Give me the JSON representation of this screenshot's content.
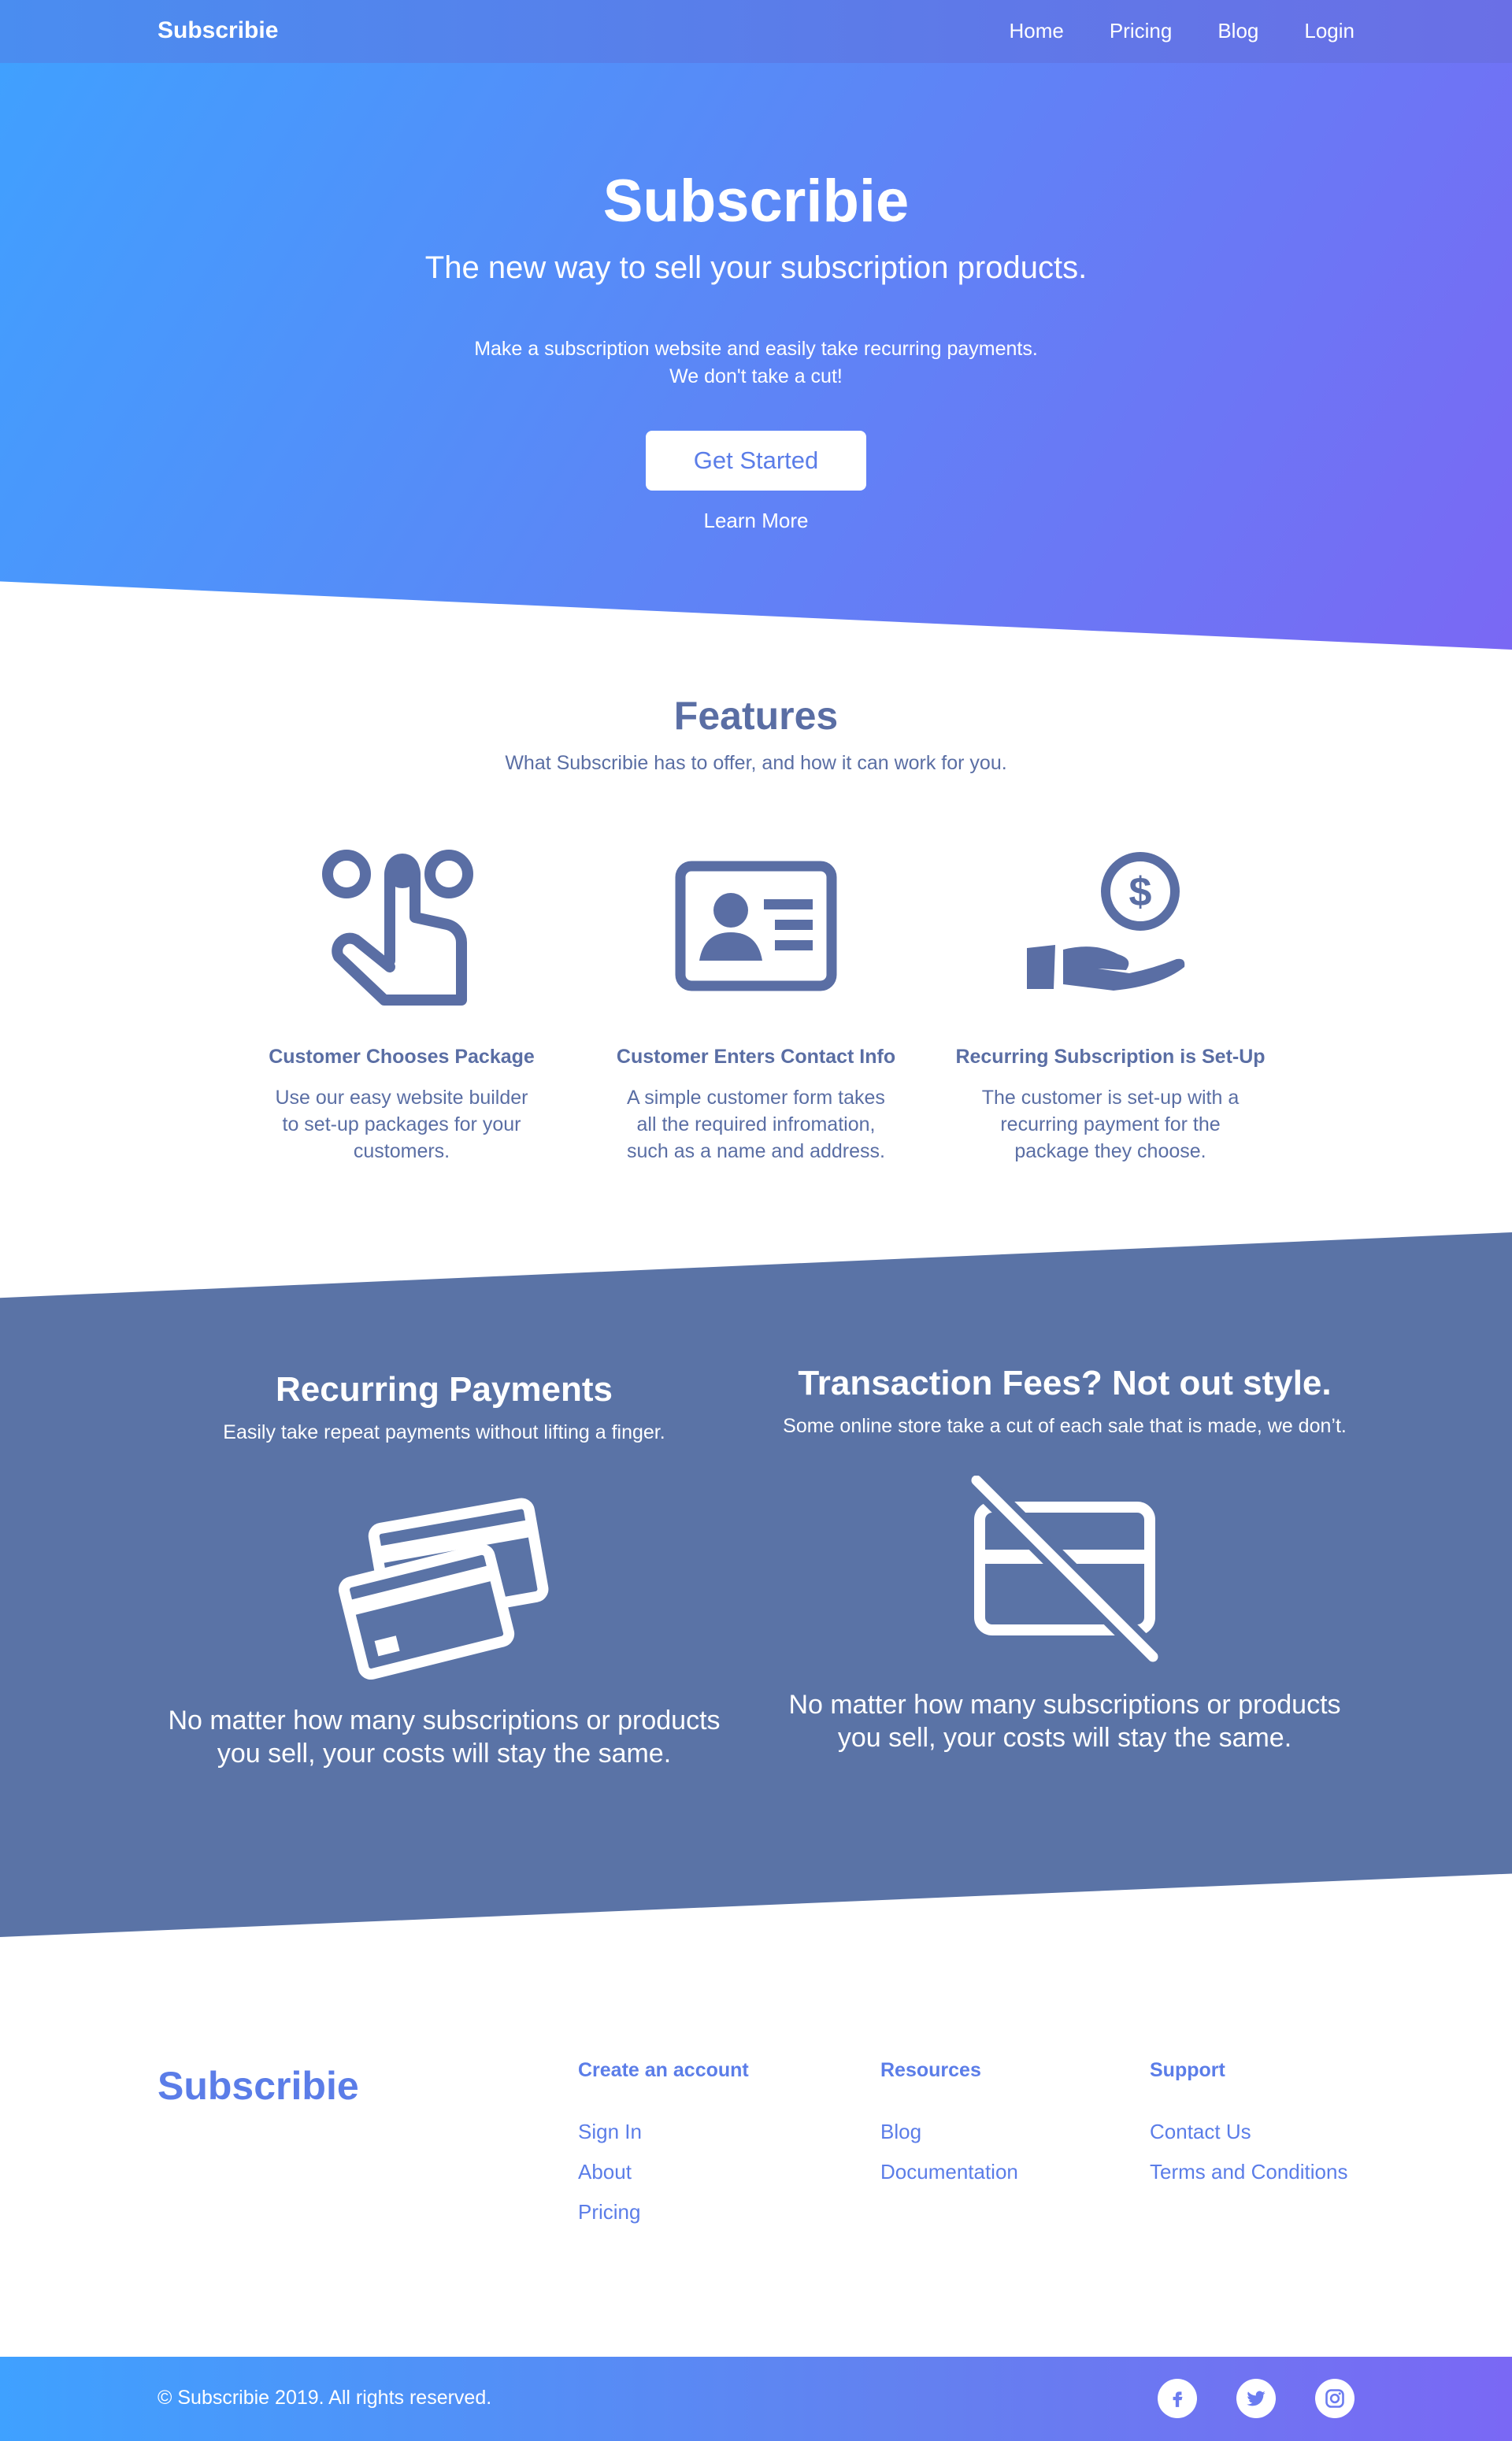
{
  "nav": {
    "brand": "Subscribie",
    "links": [
      "Home",
      "Pricing",
      "Blog",
      "Login"
    ]
  },
  "hero": {
    "title": "Subscribie",
    "subtitle": "The new way to sell your subscription products.",
    "desc_line1": "Make a subscription website and easily take recurring payments.",
    "desc_line2": "We don't take a cut!",
    "cta": "Get Started",
    "learn_more": "Learn More"
  },
  "features": {
    "title": "Features",
    "subtitle": "What Subscribie has to offer, and how it can work for you.",
    "items": [
      {
        "icon": "hand-tap-icon",
        "title": "Customer Chooses Package",
        "text": "Use our easy website builder to set-up packages for your customers."
      },
      {
        "icon": "id-card-icon",
        "title": "Customer Enters Contact Info",
        "text": "A simple customer form takes all the required infromation, such as a name and address."
      },
      {
        "icon": "hand-coin-icon",
        "title": "Recurring Subscription is Set-Up",
        "text": "The customer is set-up with a recurring payment for the package they choose."
      }
    ]
  },
  "band": {
    "left": {
      "title": "Recurring Payments",
      "subtitle": "Easily take repeat payments without lifting a finger.",
      "icon": "credit-cards-icon",
      "body": "No matter how many subscriptions or products you sell, your costs will stay the same."
    },
    "right": {
      "title": "Transaction Fees? Not out style.",
      "subtitle": "Some online store take a cut of each sale that is made, we don’t.",
      "icon": "no-card-icon",
      "body": "No matter how many subscriptions or products you sell, your costs will stay the same."
    }
  },
  "footer": {
    "brand": "Subscribie",
    "columns": [
      {
        "heading": "Create an account",
        "links": [
          "Sign In",
          "About",
          "Pricing"
        ]
      },
      {
        "heading": "Resources",
        "links": [
          "Blog",
          "Documentation"
        ]
      },
      {
        "heading": "Support",
        "links": [
          "Contact Us",
          "Terms and Conditions"
        ]
      }
    ],
    "copyright": "© Subscribie 2019. All rights reserved.",
    "socials": [
      "facebook-icon",
      "twitter-icon",
      "instagram-icon"
    ]
  },
  "colors": {
    "accent": "#5b7de8",
    "text": "#5a6ea4",
    "band": "#5a73a6"
  }
}
